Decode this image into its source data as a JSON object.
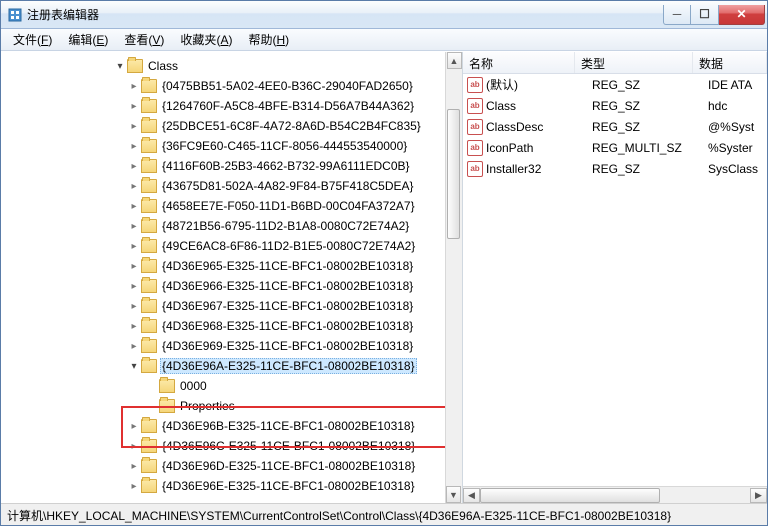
{
  "title": "注册表编辑器",
  "menu": {
    "file": "文件",
    "edit": "编辑",
    "view": "查看",
    "fav": "收藏夹",
    "help": "帮助",
    "file_u": "F",
    "edit_u": "E",
    "view_u": "V",
    "fav_u": "A",
    "help_u": "H"
  },
  "tree": {
    "root": "Class",
    "items": [
      "{0475BB51-5A02-4EE0-B36C-29040FAD2650}",
      "{1264760F-A5C8-4BFE-B314-D56A7B44A362}",
      "{25DBCE51-6C8F-4A72-8A6D-B54C2B4FC835}",
      "{36FC9E60-C465-11CF-8056-444553540000}",
      "{4116F60B-25B3-4662-B732-99A6111EDC0B}",
      "{43675D81-502A-4A82-9F84-B75F418C5DEA}",
      "{4658EE7E-F050-11D1-B6BD-00C04FA372A7}",
      "{48721B56-6795-11D2-B1A8-0080C72E74A2}",
      "{49CE6AC8-6F86-11D2-B1E5-0080C72E74A2}",
      "{4D36E965-E325-11CE-BFC1-08002BE10318}",
      "{4D36E966-E325-11CE-BFC1-08002BE10318}",
      "{4D36E967-E325-11CE-BFC1-08002BE10318}",
      "{4D36E968-E325-11CE-BFC1-08002BE10318}",
      "{4D36E969-E325-11CE-BFC1-08002BE10318}"
    ],
    "selected": "{4D36E96A-E325-11CE-BFC1-08002BE10318}",
    "children": [
      "0000",
      "Properties"
    ],
    "after": [
      "{4D36E96B-E325-11CE-BFC1-08002BE10318}",
      "{4D36E96C-E325-11CE-BFC1-08002BE10318}",
      "{4D36E96D-E325-11CE-BFC1-08002BE10318}",
      "{4D36E96E-E325-11CE-BFC1-08002BE10318}"
    ]
  },
  "list": {
    "headers": {
      "name": "名称",
      "type": "类型",
      "data": "数据"
    },
    "rows": [
      {
        "name": "(默认)",
        "type": "REG_SZ",
        "data": "IDE ATA"
      },
      {
        "name": "Class",
        "type": "REG_SZ",
        "data": "hdc"
      },
      {
        "name": "ClassDesc",
        "type": "REG_SZ",
        "data": "@%Syst"
      },
      {
        "name": "IconPath",
        "type": "REG_MULTI_SZ",
        "data": "%Syster"
      },
      {
        "name": "Installer32",
        "type": "REG_SZ",
        "data": "SysClass"
      }
    ]
  },
  "status": "计算机\\HKEY_LOCAL_MACHINE\\SYSTEM\\CurrentControlSet\\Control\\Class\\{4D36E96A-E325-11CE-BFC1-08002BE10318}",
  "icon_label": "ab"
}
